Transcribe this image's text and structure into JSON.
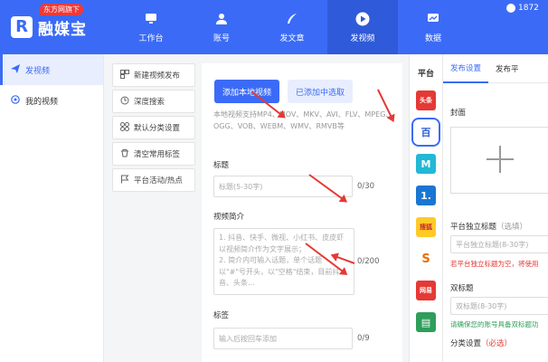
{
  "app": {
    "badge": "东方网旗下",
    "logo_mark": "R",
    "name": "融媒宝",
    "phone_partial": "1872",
    "brand_color": "#3b6bf6"
  },
  "nav": [
    {
      "label": "工作台",
      "icon": "monitor-icon"
    },
    {
      "label": "账号",
      "icon": "user-icon"
    },
    {
      "label": "发文章",
      "icon": "pen-icon"
    },
    {
      "label": "发视频",
      "icon": "play-icon",
      "active": true
    },
    {
      "label": "数据",
      "icon": "chart-icon"
    }
  ],
  "sidebar": [
    {
      "label": "发视频",
      "icon": "send-icon",
      "active": true
    },
    {
      "label": "我的视频",
      "icon": "video-icon"
    }
  ],
  "tools": [
    {
      "label": "新建视频发布",
      "icon": "new-icon"
    },
    {
      "label": "深度搜索",
      "icon": "search-icon"
    },
    {
      "label": "默认分类设置",
      "icon": "category-icon"
    },
    {
      "label": "清空常用标签",
      "icon": "clear-icon"
    },
    {
      "label": "平台活动/热点",
      "icon": "flag-icon"
    }
  ],
  "form": {
    "add_local_button": "添加本地视频",
    "add_existing_button": "已添加中选取",
    "supported_formats": "本地视频支持MP4、MOV、MKV、AVI、FLV、MPEG、OGG、VOB、WEBM、WMV、RMVB等",
    "title_label": "标题",
    "title_placeholder": "标题(5-30字)",
    "title_counter": "0/30",
    "intro_label": "视频简介",
    "intro_placeholder_lines": [
      "1. 抖音、快手、微视、小红书、皮皮虾",
      "以视频简介作为文字展示；",
      "2. 简介内可输入话题，单个话题",
      "以\"#\"号开头，以\"空格\"结束，目前抖",
      "音、头条..."
    ],
    "intro_counter": "0/200",
    "tags_label": "标签",
    "tags_placeholder": "输入后按回车添加",
    "tags_counter": "0/9"
  },
  "platforms": {
    "header": "平台",
    "items": [
      {
        "name": "头条",
        "text": "头条",
        "color": "#e53935",
        "icon": "toutiao-icon"
      },
      {
        "name": "百家号",
        "text": "百",
        "color": "#ffffff",
        "icon": "baijiahao-icon",
        "selected": true
      },
      {
        "name": "大鱼号",
        "text": "M",
        "color": "#22b8d6",
        "icon": "dayu-icon"
      },
      {
        "name": "一点号",
        "text": "1.",
        "color": "#1976d2",
        "icon": "yidian-icon"
      },
      {
        "name": "搜狐号",
        "text": "搜狐",
        "color": "#ffca28",
        "icon": "sohu-icon"
      },
      {
        "name": "微博",
        "text": "S",
        "color": "#ffffff",
        "icon": "weibo-icon"
      },
      {
        "name": "网易号",
        "text": "网易",
        "color": "#e53935",
        "icon": "wangyi-icon"
      },
      {
        "name": "企鹅号",
        "text": "▤",
        "color": "#2e9e5b",
        "icon": "qie-icon"
      }
    ]
  },
  "settings": {
    "tabs": [
      "发布设置",
      "发布平"
    ],
    "cover_label": "封面",
    "standalone_title_label": "平台独立标题",
    "standalone_title_hint": "（选填）",
    "standalone_title_placeholder": "平台独立标题(8-30字)",
    "standalone_title_warning": "若平台独立标题为空，将使用",
    "double_title_label": "双标题",
    "double_title_placeholder": "双标题(8-30字)",
    "double_title_warning": "请确保您的账号具备双标题功",
    "category_label": "分类设置",
    "category_required": "（必选）"
  }
}
